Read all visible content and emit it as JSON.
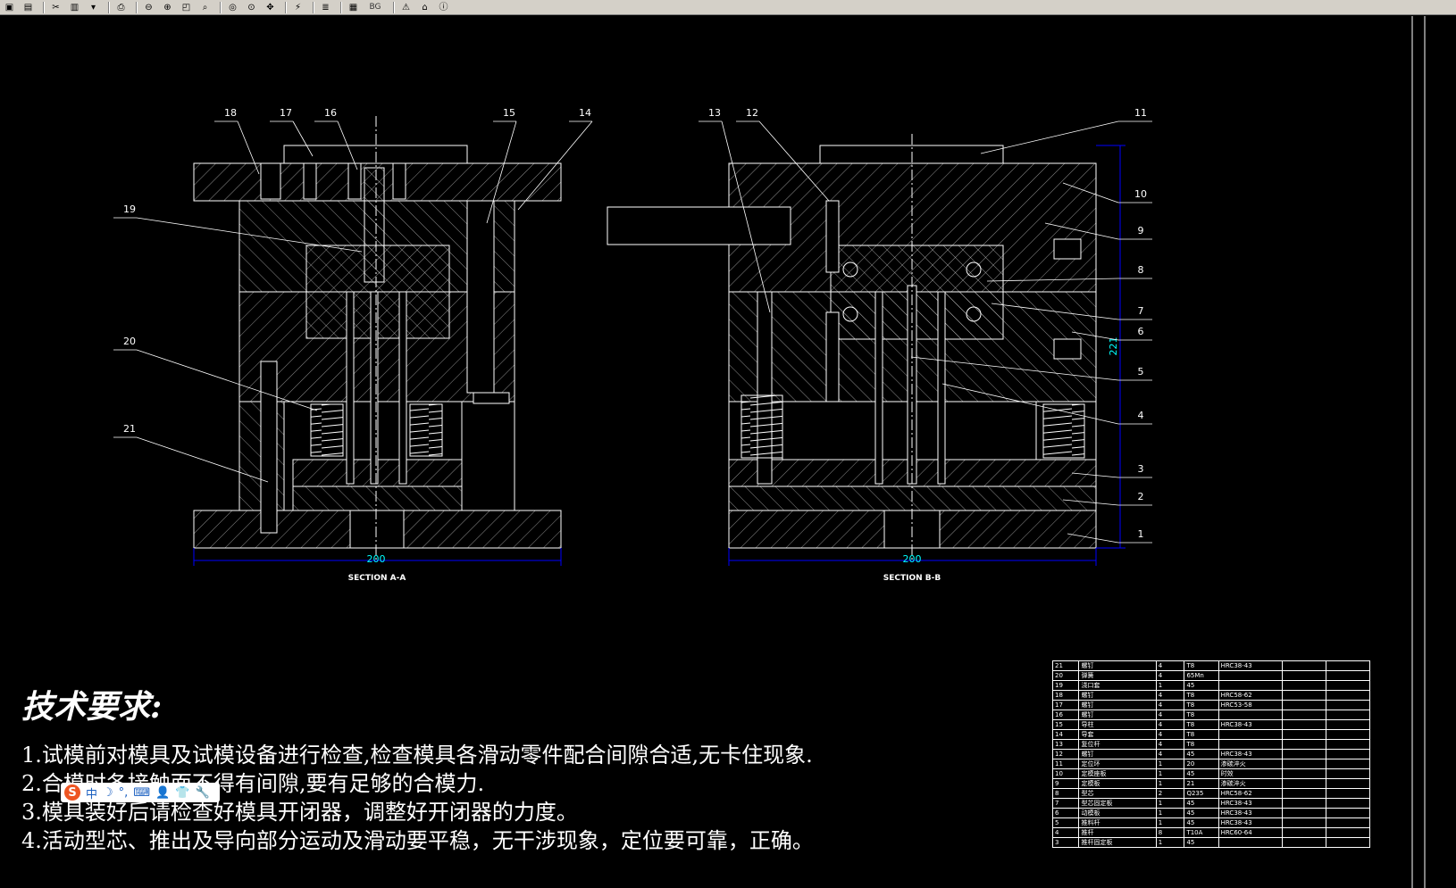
{
  "toolbar": {
    "buttons": [
      {
        "name": "save-icon",
        "glyph": "▣"
      },
      {
        "name": "save-as-icon",
        "glyph": "▤"
      },
      {
        "name": "sep",
        "glyph": ""
      },
      {
        "name": "cut-icon",
        "glyph": "✂"
      },
      {
        "name": "paste-icon",
        "glyph": "▥"
      },
      {
        "name": "dropdown-icon",
        "glyph": "▾"
      },
      {
        "name": "sep",
        "glyph": ""
      },
      {
        "name": "print-icon",
        "glyph": "⎙"
      },
      {
        "name": "sep",
        "glyph": ""
      },
      {
        "name": "zoom-out-icon",
        "glyph": "⊖"
      },
      {
        "name": "zoom-in-icon",
        "glyph": "⊕"
      },
      {
        "name": "zoom-window-icon",
        "glyph": "◰"
      },
      {
        "name": "zoom-realtime-icon",
        "glyph": "⌕"
      },
      {
        "name": "sep",
        "glyph": ""
      },
      {
        "name": "zoom-previous-icon",
        "glyph": "◎"
      },
      {
        "name": "zoom-extents-icon",
        "glyph": "⊙"
      },
      {
        "name": "pan-icon",
        "glyph": "✥"
      },
      {
        "name": "sep",
        "glyph": ""
      },
      {
        "name": "regen-icon",
        "glyph": "⚡"
      },
      {
        "name": "sep",
        "glyph": ""
      },
      {
        "name": "layers-icon",
        "glyph": "≣"
      },
      {
        "name": "sep",
        "glyph": ""
      },
      {
        "name": "layout-icon",
        "glyph": "▦"
      }
    ],
    "bg_label": "BG",
    "warning_glyph": "⚠",
    "home_glyph": "⌂",
    "info_glyph": "ⓘ"
  },
  "drawing": {
    "section_a_label": "SECTION A-A",
    "section_b_label": "SECTION B-B",
    "dim_a": "200",
    "dim_b": "200",
    "dim_height": "221",
    "balloons_left": [
      "18",
      "17",
      "16",
      "15",
      "14",
      "19",
      "20",
      "21"
    ],
    "balloons_mid": [
      "13",
      "12"
    ],
    "balloons_right": [
      "11",
      "10",
      "9",
      "8",
      "7",
      "6",
      "5",
      "4",
      "3",
      "2",
      "1"
    ]
  },
  "tech": {
    "title": "技术要求:",
    "items": [
      "1.试模前对模具及试模设备进行检查,检查模具各滑动零件配合间隙合适,无卡住现象.",
      "2.合模时各接触面不得有间隙,要有足够的合模力.",
      "3.模具装好后请检查好模具开闭器，调整好开闭器的力度。",
      "4.活动型芯、推出及导向部分运动及滑动要平稳，无干涉现象，定位要可靠，正确。"
    ]
  },
  "ime": {
    "logo": "S",
    "items": [
      "中",
      "☽",
      "°,",
      "⌨",
      "👤",
      "👕",
      "🔧"
    ]
  },
  "bom": {
    "rows": [
      [
        "21",
        "螺钉",
        "4",
        "T8",
        "HRC38-43",
        "",
        ""
      ],
      [
        "20",
        "弹簧",
        "4",
        "65Mn",
        "",
        "",
        ""
      ],
      [
        "19",
        "浇口套",
        "1",
        "45",
        "",
        "",
        ""
      ],
      [
        "18",
        "螺钉",
        "4",
        "T8",
        "HRC58-62",
        "",
        ""
      ],
      [
        "17",
        "螺钉",
        "4",
        "T8",
        "HRC53-58",
        "",
        ""
      ],
      [
        "16",
        "螺钉",
        "4",
        "T8",
        "",
        "",
        ""
      ],
      [
        "15",
        "导柱",
        "4",
        "T8",
        "HRC38-43",
        "",
        ""
      ],
      [
        "14",
        "导套",
        "4",
        "T8",
        "",
        "",
        ""
      ],
      [
        "13",
        "复位杆",
        "4",
        "T8",
        "",
        "",
        ""
      ],
      [
        "12",
        "螺钉",
        "4",
        "45",
        "HRC38-43",
        "",
        ""
      ],
      [
        "11",
        "定位环",
        "1",
        "20",
        "渗碳淬火",
        "",
        ""
      ],
      [
        "10",
        "定模座板",
        "1",
        "45",
        "时效",
        "",
        ""
      ],
      [
        "9",
        "定模板",
        "1",
        "21",
        "渗碳淬火",
        "",
        ""
      ],
      [
        "8",
        "型芯",
        "2",
        "Q235",
        "HRC58-62",
        "",
        ""
      ],
      [
        "7",
        "型芯固定板",
        "1",
        "45",
        "HRC38-43",
        "",
        ""
      ],
      [
        "6",
        "动模板",
        "1",
        "45",
        "HRC38-43",
        "",
        ""
      ],
      [
        "5",
        "推料杆",
        "1",
        "45",
        "HRC38-43",
        "",
        ""
      ],
      [
        "4",
        "推杆",
        "8",
        "T10A",
        "HRC60-64",
        "",
        ""
      ],
      [
        "3",
        "推杆固定板",
        "1",
        "45",
        "",
        "",
        ""
      ]
    ]
  }
}
